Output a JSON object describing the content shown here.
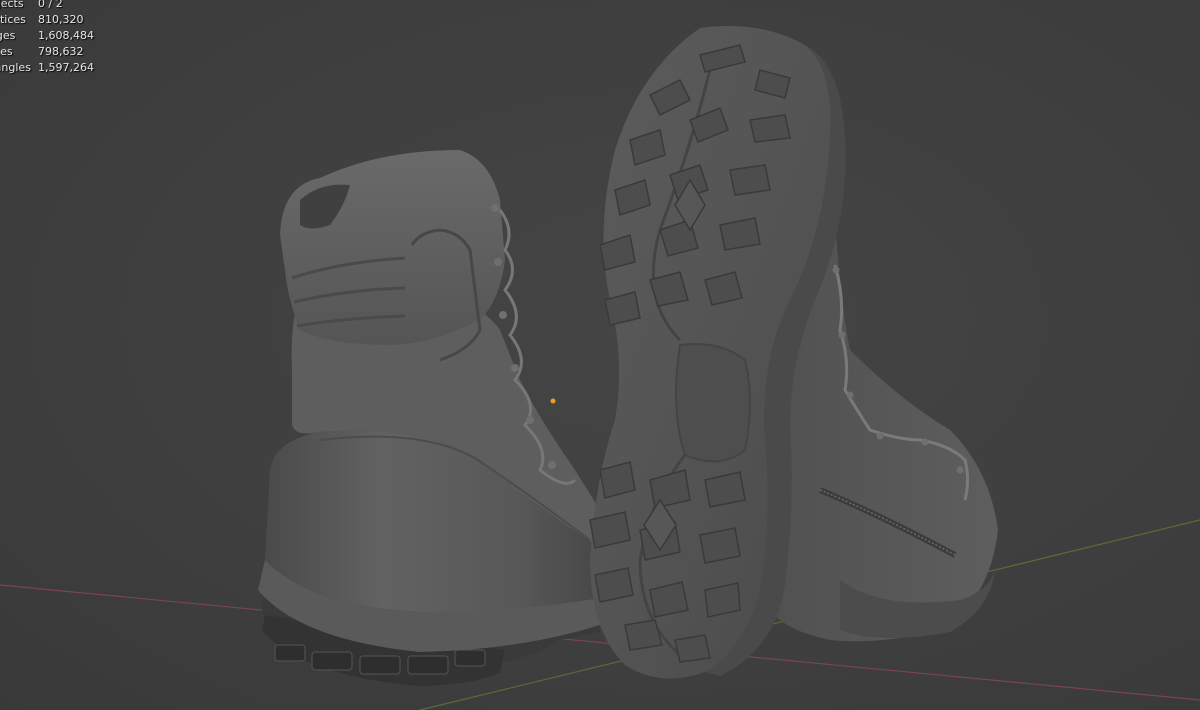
{
  "viewport": {
    "stats": [
      {
        "label": "Objects",
        "value": "0 / 2"
      },
      {
        "label": "Vertices",
        "value": "810,320"
      },
      {
        "label": "Edges",
        "value": "1,608,484"
      },
      {
        "label": "Faces",
        "value": "798,632"
      },
      {
        "label": "Triangles",
        "value": "1,597,264"
      }
    ]
  },
  "colors": {
    "background": "#3d3d3d",
    "x_axis": "#9a4a52",
    "y_axis": "#6a8a3a",
    "origin": "#e8a020",
    "model": "#5a5a5a"
  }
}
